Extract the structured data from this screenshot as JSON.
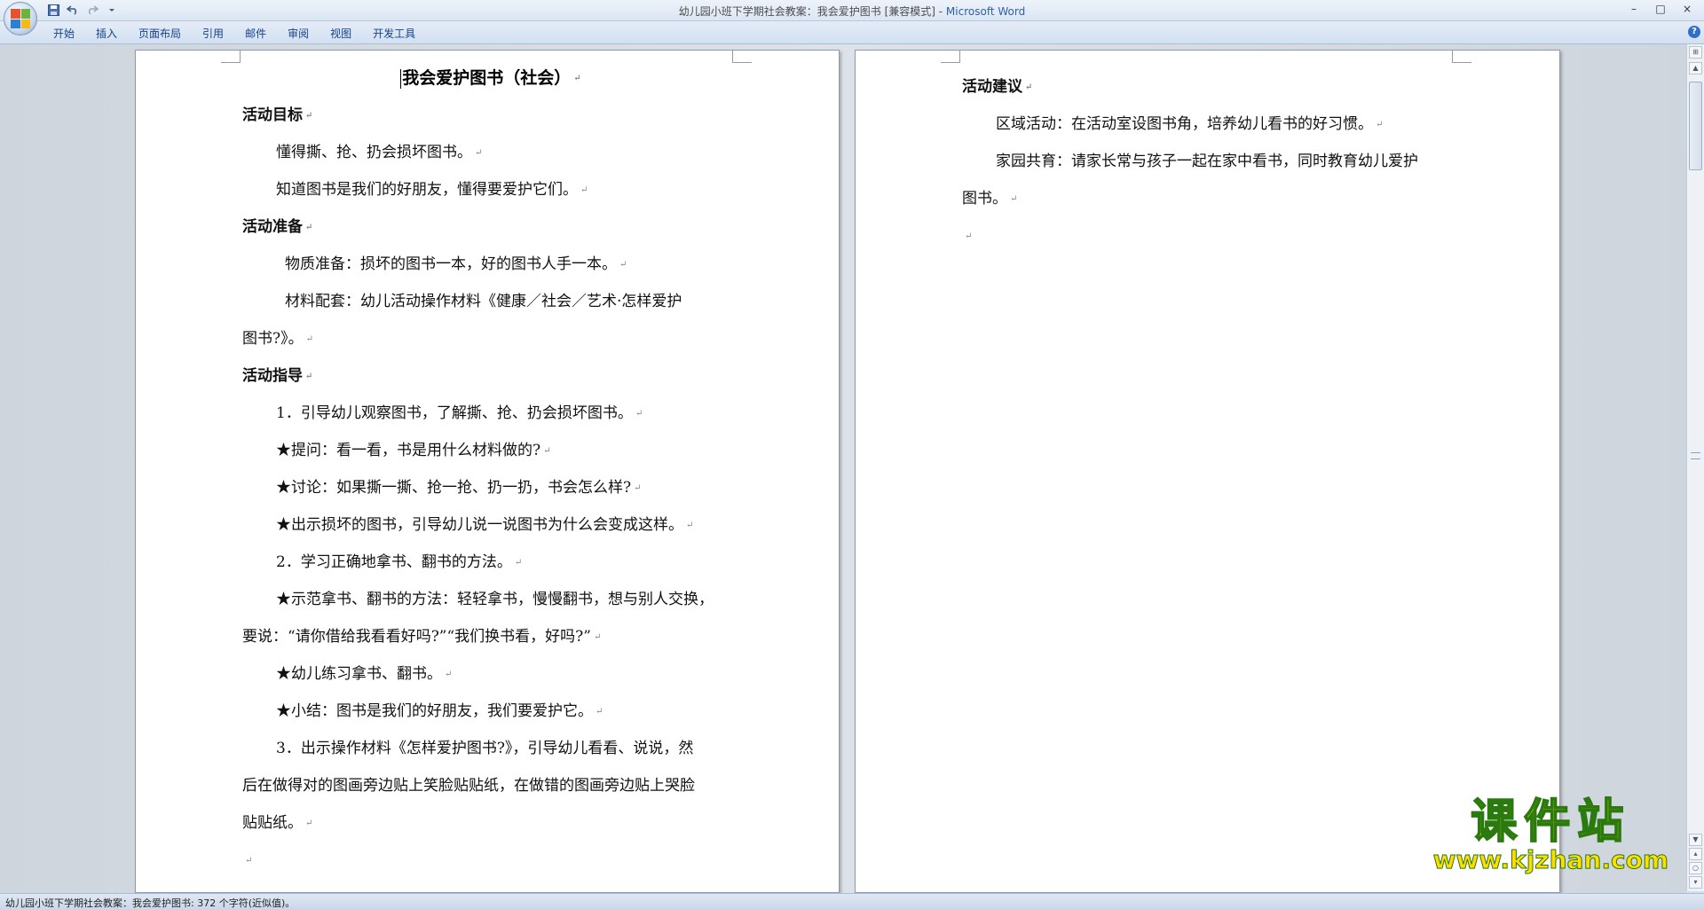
{
  "window": {
    "title_doc": "幼儿园小班下学期社会教案：我会爱护图书 [兼容模式] - ",
    "title_app": "Microsoft Word",
    "controls": [
      "–",
      "□",
      "×"
    ]
  },
  "quick_access": {
    "save_icon": "save-icon",
    "undo_icon": "undo-icon",
    "redo_icon": "redo-icon",
    "customize_icon": "dropdown-icon"
  },
  "ribbon": {
    "tabs": [
      "开始",
      "插入",
      "页面布局",
      "引用",
      "邮件",
      "审阅",
      "视图",
      "开发工具"
    ],
    "help": "?"
  },
  "document": {
    "page1": {
      "title": "我会爱护图书（社会）",
      "lines": [
        "活动目标",
        "懂得撕、抢、扔会损坏图书。",
        "知道图书是我们的好朋友，懂得要爱护它们。",
        "活动准备",
        "物质准备：损坏的图书一本，好的图书人手一本。",
        "材料配套：幼儿活动操作材料《健康／社会／艺术·怎样爱护",
        "图书?》。",
        "活动指导",
        "1．引导幼儿观察图书，了解撕、抢、扔会损坏图书。",
        "★提问：看一看，书是用什么材料做的?",
        "★讨论：如果撕一撕、抢一抢、扔一扔，书会怎么样?",
        "★出示损坏的图书，引导幼儿说一说图书为什么会变成这样。",
        "2．学习正确地拿书、翻书的方法。",
        "★示范拿书、翻书的方法：轻轻拿书，慢慢翻书，想与别人交换，",
        "要说：“请你借给我看看好吗?”“我们换书看，好吗?”",
        "★幼儿练习拿书、翻书。",
        "★小结：图书是我们的好朋友，我们要爱护它。",
        "3．出示操作材料《怎样爱护图书?》，引导幼儿看看、说说，然",
        "后在做得对的图画旁边贴上笑脸贴贴纸，在做错的图画旁边贴上哭脸",
        "贴贴纸。",
        ""
      ]
    },
    "page2": {
      "lines": [
        "活动建议",
        "区域活动：在活动室设图书角，培养幼儿看书的好习惯。",
        "家园共育：请家长常与孩子一起在家中看书，同时教育幼儿爱护",
        "图书。",
        ""
      ]
    },
    "paragraph_mark": "↵"
  },
  "status": {
    "text": "幼儿园小班下学期社会教案：我会爱护图书: 372 个字符(近似值)。"
  },
  "watermark": {
    "title": "课件站",
    "url": "www.kjzhan.com"
  },
  "colors": {
    "title_app": "#2e5fa8",
    "tab_text": "#15428b",
    "watermark_fill": "#ffdd00",
    "watermark_stroke": "#2a7a0f"
  }
}
